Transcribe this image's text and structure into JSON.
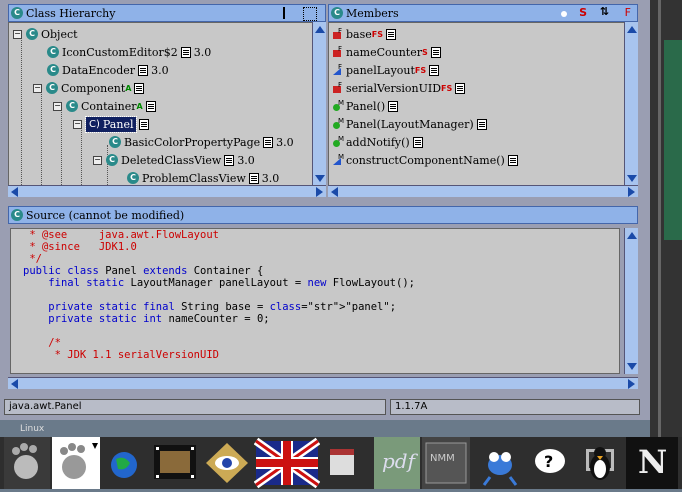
{
  "hierarchy": {
    "title": "Class Hierarchy",
    "rows": [
      {
        "label": "Object",
        "mods": "",
        "version": ""
      },
      {
        "label": "IconCustomEditor$2",
        "mods": "",
        "version": "3.0"
      },
      {
        "label": "DataEncoder",
        "mods": "",
        "version": "3.0"
      },
      {
        "label": "Component",
        "mods": "A",
        "version": ""
      },
      {
        "label": "Container",
        "mods": "A",
        "version": ""
      },
      {
        "label": "Panel",
        "mods": "",
        "version": ""
      },
      {
        "label": "BasicColorPropertyPage",
        "mods": "",
        "version": "3.0"
      },
      {
        "label": "DeletedClassView",
        "mods": "",
        "version": "3.0"
      },
      {
        "label": "ProblemClassView",
        "mods": "",
        "version": "3.0"
      }
    ]
  },
  "members": {
    "title": "Members",
    "header_s": "S",
    "header_f": "F",
    "rows": [
      {
        "label": "base",
        "mods": "FS"
      },
      {
        "label": "nameCounter",
        "mods": "S"
      },
      {
        "label": "panelLayout",
        "mods": "FS"
      },
      {
        "label": "serialVersionUID",
        "mods": "FS"
      },
      {
        "label": "Panel()",
        "mods": ""
      },
      {
        "label": "Panel(LayoutManager)",
        "mods": ""
      },
      {
        "label": "addNotify()",
        "mods": ""
      },
      {
        "label": "constructComponentName()",
        "mods": ""
      }
    ]
  },
  "source": {
    "title": "Source (cannot be modified)",
    "lines": [
      " * @see     java.awt.FlowLayout",
      " * @since   JDK1.0",
      " */",
      "public class Panel extends Container {",
      "    final static LayoutManager panelLayout = new FlowLayout();",
      "",
      "    private static final String base = \"panel\";",
      "    private static int nameCounter = 0;",
      "",
      "    /*",
      "     * JDK 1.1 serialVersionUID"
    ]
  },
  "status": {
    "class_name": "java.awt.Panel",
    "version": "1.1.7A"
  },
  "taskbar": {
    "linux_label": "Linux",
    "icons": [
      "gnome-foot-icon",
      "gnome-help-foot-icon",
      "globe-icon",
      "film-icon",
      "eye-icon",
      "uk-flag-icon",
      "calendar-icon",
      "pdf-icon",
      "nmm-system-icon",
      "ant-icon",
      "question-icon",
      "penguin-icon",
      "netscape-icon"
    ],
    "pdf_label": "pdf",
    "netscape_label": "N"
  }
}
